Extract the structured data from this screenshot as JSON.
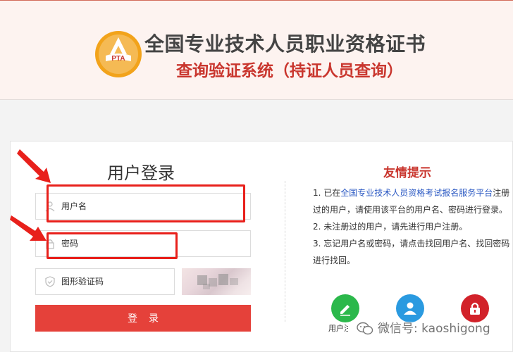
{
  "header": {
    "logo_text": "PTA",
    "title": "全国专业技术人员职业资格证书",
    "subtitle": "查询验证系统（持证人员查询）"
  },
  "login": {
    "title": "用户登录",
    "username_placeholder": "用户名",
    "password_placeholder": "密码",
    "captcha_placeholder": "图形验证码",
    "submit_label": "登录"
  },
  "tips": {
    "title": "友情提示",
    "item1_prefix": "1. 已在",
    "item1_link": "全国专业技术人员资格考试报名服务平台",
    "item1_suffix": "注册过的用户，请使用该平台的用户名、密码进行登录。",
    "item2": "2. 未注册过的用户，请先进行用户注册。",
    "item3": "3. 忘记用户名或密码，请点击找回用户名、找回密码进行找回。"
  },
  "actions": {
    "register_label": "用户注册"
  },
  "watermark": "微信号: kaoshigong",
  "colors": {
    "brand_red": "#e5413a",
    "title_red": "#c9362e",
    "annotation_red": "#e8201b",
    "register_green": "#2bb84b",
    "user_blue": "#2a9ae0",
    "lock_red": "#d2222a"
  }
}
